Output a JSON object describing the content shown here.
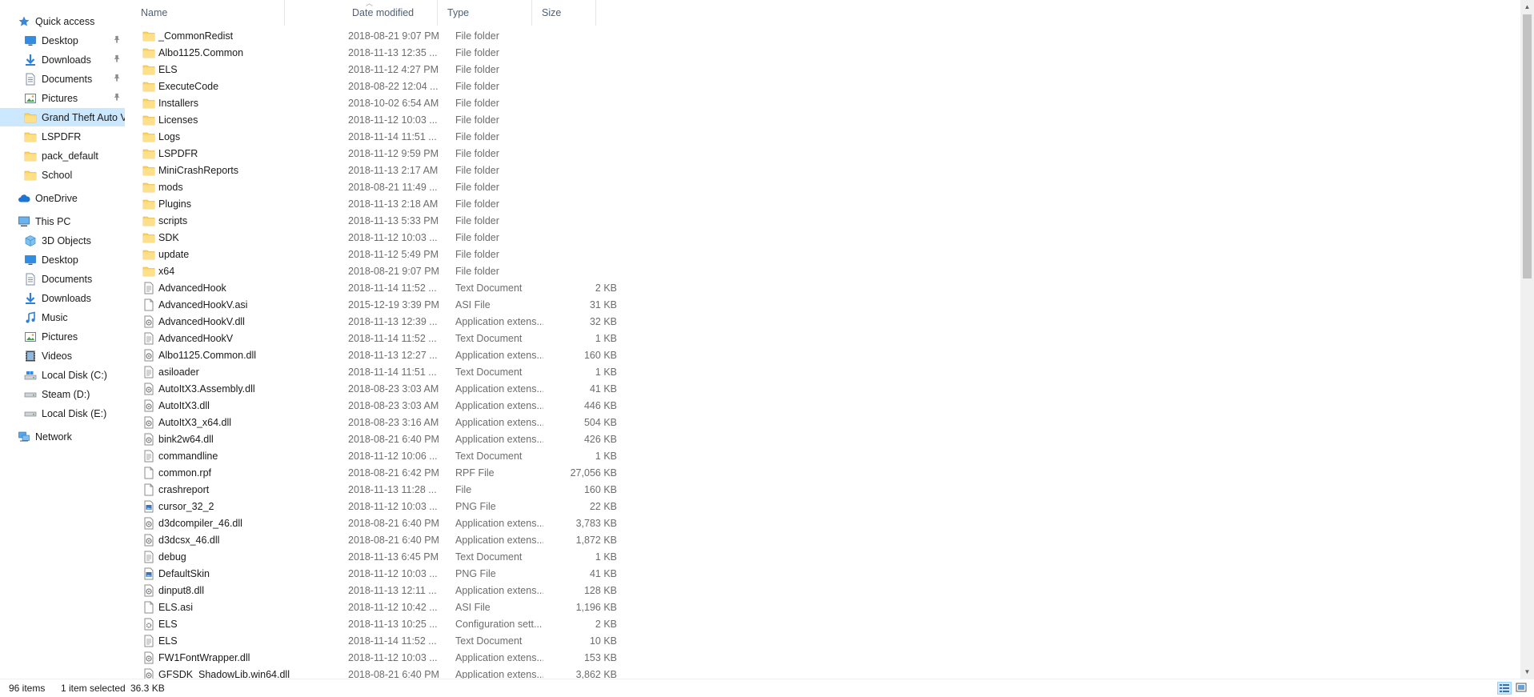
{
  "nav": {
    "items": [
      {
        "label": "Quick access",
        "icon": "star-icon",
        "level": 0,
        "pinned": false
      },
      {
        "label": "Desktop",
        "icon": "desktop-icon",
        "level": 1,
        "pinned": true
      },
      {
        "label": "Downloads",
        "icon": "download-icon",
        "level": 1,
        "pinned": true
      },
      {
        "label": "Documents",
        "icon": "document-icon",
        "level": 1,
        "pinned": true
      },
      {
        "label": "Pictures",
        "icon": "pictures-icon",
        "level": 1,
        "pinned": true
      },
      {
        "label": "Grand Theft Auto V",
        "icon": "folder-icon",
        "level": 1,
        "pinned": false,
        "selected": true
      },
      {
        "label": "LSPDFR",
        "icon": "folder-icon",
        "level": 1,
        "pinned": false
      },
      {
        "label": "pack_default",
        "icon": "folder-icon",
        "level": 1,
        "pinned": false
      },
      {
        "label": "School",
        "icon": "folder-icon",
        "level": 1,
        "pinned": false
      },
      {
        "label": "OneDrive",
        "icon": "cloud-icon",
        "level": 0,
        "pinned": false,
        "gap": true
      },
      {
        "label": "This PC",
        "icon": "pc-icon",
        "level": 0,
        "pinned": false,
        "gap": true
      },
      {
        "label": "3D Objects",
        "icon": "cube-icon",
        "level": 1,
        "pinned": false
      },
      {
        "label": "Desktop",
        "icon": "desktop-icon",
        "level": 1,
        "pinned": false
      },
      {
        "label": "Documents",
        "icon": "document-icon",
        "level": 1,
        "pinned": false
      },
      {
        "label": "Downloads",
        "icon": "download-icon",
        "level": 1,
        "pinned": false
      },
      {
        "label": "Music",
        "icon": "music-icon",
        "level": 1,
        "pinned": false
      },
      {
        "label": "Pictures",
        "icon": "pictures-icon",
        "level": 1,
        "pinned": false
      },
      {
        "label": "Videos",
        "icon": "video-icon",
        "level": 1,
        "pinned": false
      },
      {
        "label": "Local Disk (C:)",
        "icon": "drive-c-icon",
        "level": 1,
        "pinned": false
      },
      {
        "label": "Steam (D:)",
        "icon": "drive-icon",
        "level": 1,
        "pinned": false
      },
      {
        "label": "Local Disk (E:)",
        "icon": "drive-icon",
        "level": 1,
        "pinned": false
      },
      {
        "label": "Network",
        "icon": "network-icon",
        "level": 0,
        "pinned": false,
        "gap": true
      }
    ]
  },
  "columns": {
    "name": "Name",
    "date": "Date modified",
    "type": "Type",
    "size": "Size"
  },
  "files": [
    {
      "name": "_CommonRedist",
      "date": "2018-08-21 9:07 PM",
      "type": "File folder",
      "size": "",
      "icon": "folder-icon"
    },
    {
      "name": "Albo1125.Common",
      "date": "2018-11-13 12:35 ...",
      "type": "File folder",
      "size": "",
      "icon": "folder-icon"
    },
    {
      "name": "ELS",
      "date": "2018-11-12 4:27 PM",
      "type": "File folder",
      "size": "",
      "icon": "folder-icon"
    },
    {
      "name": "ExecuteCode",
      "date": "2018-08-22 12:04 ...",
      "type": "File folder",
      "size": "",
      "icon": "folder-icon"
    },
    {
      "name": "Installers",
      "date": "2018-10-02 6:54 AM",
      "type": "File folder",
      "size": "",
      "icon": "folder-icon"
    },
    {
      "name": "Licenses",
      "date": "2018-11-12 10:03 ...",
      "type": "File folder",
      "size": "",
      "icon": "folder-icon"
    },
    {
      "name": "Logs",
      "date": "2018-11-14 11:51 ...",
      "type": "File folder",
      "size": "",
      "icon": "folder-icon"
    },
    {
      "name": "LSPDFR",
      "date": "2018-11-12 9:59 PM",
      "type": "File folder",
      "size": "",
      "icon": "folder-icon"
    },
    {
      "name": "MiniCrashReports",
      "date": "2018-11-13 2:17 AM",
      "type": "File folder",
      "size": "",
      "icon": "folder-icon"
    },
    {
      "name": "mods",
      "date": "2018-08-21 11:49 ...",
      "type": "File folder",
      "size": "",
      "icon": "folder-icon"
    },
    {
      "name": "Plugins",
      "date": "2018-11-13 2:18 AM",
      "type": "File folder",
      "size": "",
      "icon": "folder-icon"
    },
    {
      "name": "scripts",
      "date": "2018-11-13 5:33 PM",
      "type": "File folder",
      "size": "",
      "icon": "folder-icon"
    },
    {
      "name": "SDK",
      "date": "2018-11-12 10:03 ...",
      "type": "File folder",
      "size": "",
      "icon": "folder-icon"
    },
    {
      "name": "update",
      "date": "2018-11-12 5:49 PM",
      "type": "File folder",
      "size": "",
      "icon": "folder-icon"
    },
    {
      "name": "x64",
      "date": "2018-08-21 9:07 PM",
      "type": "File folder",
      "size": "",
      "icon": "folder-icon"
    },
    {
      "name": "AdvancedHook",
      "date": "2018-11-14 11:52 ...",
      "type": "Text Document",
      "size": "2 KB",
      "icon": "text-file-icon"
    },
    {
      "name": "AdvancedHookV.asi",
      "date": "2015-12-19 3:39 PM",
      "type": "ASI File",
      "size": "31 KB",
      "icon": "blank-file-icon"
    },
    {
      "name": "AdvancedHookV.dll",
      "date": "2018-11-13 12:39 ...",
      "type": "Application extens...",
      "size": "32 KB",
      "icon": "dll-file-icon"
    },
    {
      "name": "AdvancedHookV",
      "date": "2018-11-14 11:52 ...",
      "type": "Text Document",
      "size": "1 KB",
      "icon": "text-file-icon"
    },
    {
      "name": "Albo1125.Common.dll",
      "date": "2018-11-13 12:27 ...",
      "type": "Application extens...",
      "size": "160 KB",
      "icon": "dll-file-icon"
    },
    {
      "name": "asiloader",
      "date": "2018-11-14 11:51 ...",
      "type": "Text Document",
      "size": "1 KB",
      "icon": "text-file-icon"
    },
    {
      "name": "AutoItX3.Assembly.dll",
      "date": "2018-08-23 3:03 AM",
      "type": "Application extens...",
      "size": "41 KB",
      "icon": "dll-file-icon"
    },
    {
      "name": "AutoItX3.dll",
      "date": "2018-08-23 3:03 AM",
      "type": "Application extens...",
      "size": "446 KB",
      "icon": "dll-file-icon"
    },
    {
      "name": "AutoItX3_x64.dll",
      "date": "2018-08-23 3:16 AM",
      "type": "Application extens...",
      "size": "504 KB",
      "icon": "dll-file-icon"
    },
    {
      "name": "bink2w64.dll",
      "date": "2018-08-21 6:40 PM",
      "type": "Application extens...",
      "size": "426 KB",
      "icon": "dll-file-icon"
    },
    {
      "name": "commandline",
      "date": "2018-11-12 10:06 ...",
      "type": "Text Document",
      "size": "1 KB",
      "icon": "text-file-icon"
    },
    {
      "name": "common.rpf",
      "date": "2018-08-21 6:42 PM",
      "type": "RPF File",
      "size": "27,056 KB",
      "icon": "blank-file-icon"
    },
    {
      "name": "crashreport",
      "date": "2018-11-13 11:28 ...",
      "type": "File",
      "size": "160 KB",
      "icon": "blank-file-icon"
    },
    {
      "name": "cursor_32_2",
      "date": "2018-11-12 10:03 ...",
      "type": "PNG File",
      "size": "22 KB",
      "icon": "png-file-icon"
    },
    {
      "name": "d3dcompiler_46.dll",
      "date": "2018-08-21 6:40 PM",
      "type": "Application extens...",
      "size": "3,783 KB",
      "icon": "dll-file-icon"
    },
    {
      "name": "d3dcsx_46.dll",
      "date": "2018-08-21 6:40 PM",
      "type": "Application extens...",
      "size": "1,872 KB",
      "icon": "dll-file-icon"
    },
    {
      "name": "debug",
      "date": "2018-11-13 6:45 PM",
      "type": "Text Document",
      "size": "1 KB",
      "icon": "text-file-icon"
    },
    {
      "name": "DefaultSkin",
      "date": "2018-11-12 10:03 ...",
      "type": "PNG File",
      "size": "41 KB",
      "icon": "png-file-icon"
    },
    {
      "name": "dinput8.dll",
      "date": "2018-11-13 12:11 ...",
      "type": "Application extens...",
      "size": "128 KB",
      "icon": "dll-file-icon"
    },
    {
      "name": "ELS.asi",
      "date": "2018-11-12 10:42 ...",
      "type": "ASI File",
      "size": "1,196 KB",
      "icon": "blank-file-icon"
    },
    {
      "name": "ELS",
      "date": "2018-11-13 10:25 ...",
      "type": "Configuration sett...",
      "size": "2 KB",
      "icon": "config-file-icon"
    },
    {
      "name": "ELS",
      "date": "2018-11-14 11:52 ...",
      "type": "Text Document",
      "size": "10 KB",
      "icon": "text-file-icon"
    },
    {
      "name": "FW1FontWrapper.dll",
      "date": "2018-11-12 10:03 ...",
      "type": "Application extens...",
      "size": "153 KB",
      "icon": "dll-file-icon"
    },
    {
      "name": "GFSDK_ShadowLib.win64.dll",
      "date": "2018-08-21 6:40 PM",
      "type": "Application extens...",
      "size": "3,862 KB",
      "icon": "dll-file-icon"
    }
  ],
  "status": {
    "count": "96 items",
    "selected": "1 item selected",
    "size": "36.3 KB"
  },
  "colors": {
    "selection": "#cce8ff",
    "folder": "#ffd35c",
    "header_text": "#4c607a"
  }
}
